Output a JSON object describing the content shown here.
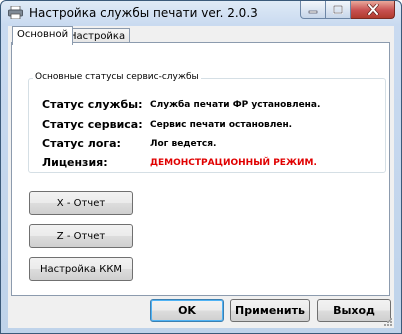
{
  "window": {
    "title": "Настройка службы печати  ver. 2.0.3"
  },
  "tabs": [
    {
      "label": "Основной",
      "active": true
    },
    {
      "label": "Настройка",
      "active": false
    }
  ],
  "status_group": {
    "title": "Основные статусы сервис-службы",
    "rows": [
      {
        "label": "Статус службы:",
        "value": "Служба печати ФР установлена."
      },
      {
        "label": "Статус сервиса:",
        "value": "Сервис печати остановлен."
      },
      {
        "label": "Статус лога:",
        "value": "Лог ведется."
      },
      {
        "label": "Лицензия:",
        "value": "ДЕМОНСТРАЦИОННЫЙ РЕЖИМ.",
        "color": "#e00000"
      }
    ]
  },
  "actions": {
    "x_report": "X - Отчет",
    "z_report": "Z - Отчет",
    "kkm_settings": "Настройка ККМ"
  },
  "footer": {
    "ok": "OK",
    "apply": "Применить",
    "exit": "Выход"
  },
  "icons": {
    "app": "printer-icon",
    "minimize": "minimize-icon",
    "maximize": "maximize-icon",
    "close": "close-icon"
  }
}
